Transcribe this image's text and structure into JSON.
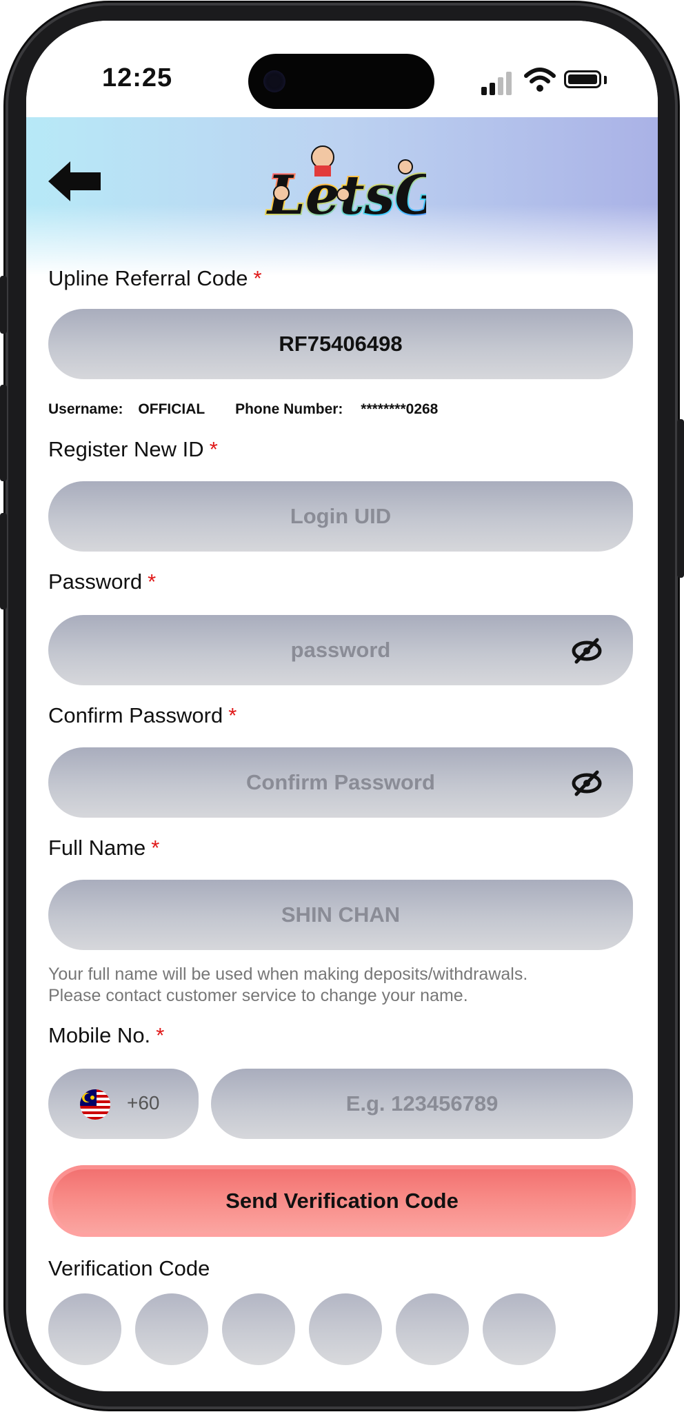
{
  "status_bar": {
    "time": "12:25"
  },
  "header": {
    "logo_text": "LetsGo"
  },
  "referral": {
    "label": "Upline Referral Code",
    "required_mark": "*",
    "value": "RF75406498",
    "username_label": "Username:",
    "username_value": "OFFICIAL",
    "phone_label": "Phone Number:",
    "phone_value": "********0268"
  },
  "register_id": {
    "label": "Register New ID",
    "required_mark": "*",
    "placeholder": "Login UID"
  },
  "password": {
    "label": "Password",
    "required_mark": "*",
    "placeholder": "password"
  },
  "confirm_password": {
    "label": "Confirm Password",
    "required_mark": "*",
    "placeholder": "Confirm Password"
  },
  "full_name": {
    "label": "Full Name",
    "required_mark": "*",
    "placeholder": "SHIN CHAN",
    "note_line1": "Your full name will be used when making deposits/withdrawals.",
    "note_line2": "Please contact customer service to change your name."
  },
  "mobile": {
    "label": "Mobile No.",
    "required_mark": "*",
    "country_code": "+60",
    "placeholder": "E.g. 123456789"
  },
  "send_button": {
    "label": "Send Verification Code"
  },
  "verification": {
    "label": "Verification Code"
  },
  "colors": {
    "accent_red": "#f16d6d",
    "required_red": "#e01818",
    "field_gray": "#c4c7d0"
  }
}
